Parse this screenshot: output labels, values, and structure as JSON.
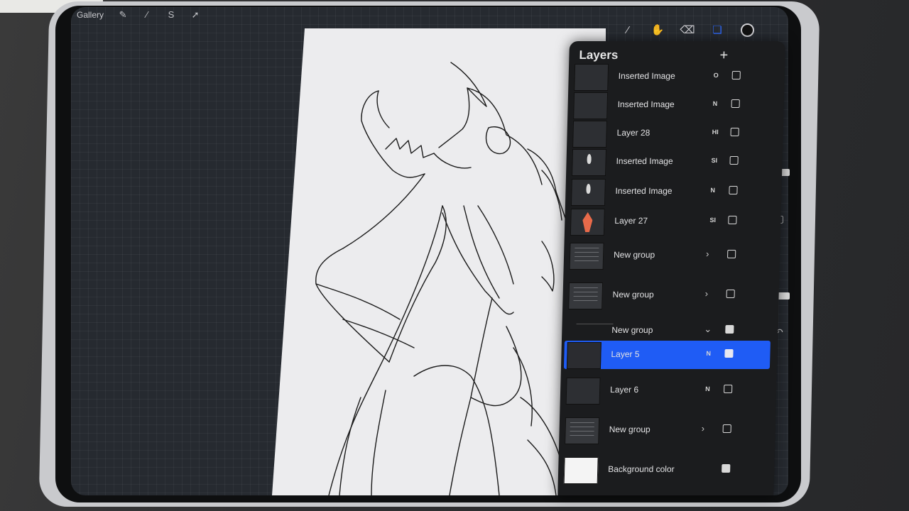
{
  "topbar": {
    "gallery_label": "Gallery",
    "icons": [
      "wrench-icon",
      "magic-wand-icon",
      "selection-s-icon",
      "transform-arrow-icon"
    ]
  },
  "tools": [
    "brush-icon",
    "smudge-icon",
    "eraser-icon",
    "layers-icon",
    "color-swatch-icon"
  ],
  "layers_panel": {
    "title": "Layers",
    "add_label": "+",
    "rows": [
      {
        "name": "Inserted Image",
        "blend": "O",
        "checked": false,
        "thumb": "plain"
      },
      {
        "name": "Inserted Image",
        "blend": "N",
        "checked": false,
        "thumb": "plain"
      },
      {
        "name": "Layer 28",
        "blend": "HI",
        "checked": false,
        "thumb": "plain"
      },
      {
        "name": "Inserted Image",
        "blend": "SI",
        "checked": false,
        "thumb": "flame"
      },
      {
        "name": "Inserted Image",
        "blend": "N",
        "checked": false,
        "thumb": "flame"
      },
      {
        "name": "Layer 27",
        "blend": "SI",
        "checked": false,
        "thumb": "red"
      },
      {
        "name": "New group",
        "blend": "›",
        "checked": false,
        "thumb": "group"
      },
      {
        "name": "New group",
        "blend": "›",
        "checked": false,
        "thumb": "group"
      },
      {
        "name": "New group",
        "blend": "⌄",
        "checked": true,
        "thumb": "none"
      },
      {
        "name": "Layer 5",
        "blend": "N",
        "checked": true,
        "thumb": "plain",
        "selected": true
      },
      {
        "name": "Layer 6",
        "blend": "N",
        "checked": false,
        "thumb": "plain"
      },
      {
        "name": "New group",
        "blend": "›",
        "checked": false,
        "thumb": "group"
      },
      {
        "name": "Background color",
        "blend": "",
        "checked": true,
        "thumb": "white"
      }
    ]
  },
  "colors": {
    "selection_blue": "#1f5cf5",
    "active_tool_blue": "#2f6bff",
    "layer27_thumb_red": "#e86a4a"
  }
}
